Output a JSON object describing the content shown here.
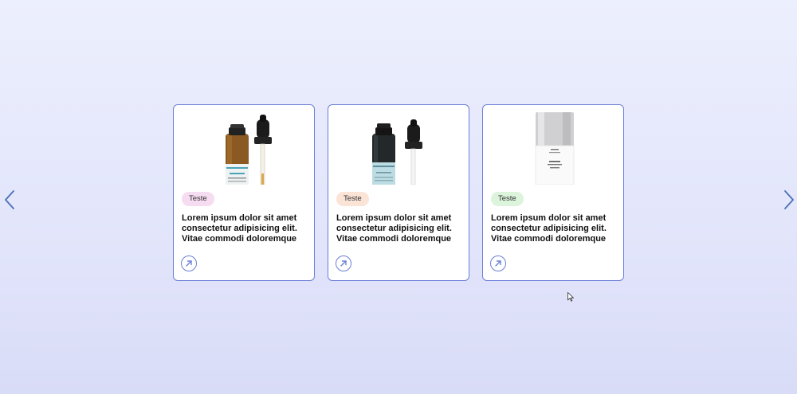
{
  "carousel": {
    "prev_icon": "chevron-left-icon",
    "next_icon": "chevron-right-icon",
    "arrow_color": "#4a6fb5",
    "card_border_color": "#6b7fd7",
    "cards": [
      {
        "tag": "Teste",
        "tag_color": "#f6dcf0",
        "title": "Lorem ipsum dolor sit amet consectetur adipisicing elit. Vitae commodi doloremque",
        "image": "amber-serum-dropper-bottle",
        "link_icon": "arrow-up-right-icon"
      },
      {
        "tag": "Teste",
        "tag_color": "#fbe3d6",
        "title": "Lorem ipsum dolor sit amet consectetur adipisicing elit. Vitae commodi doloremque",
        "image": "dark-serum-dropper-bottle",
        "link_icon": "arrow-up-right-icon"
      },
      {
        "tag": "Teste",
        "tag_color": "#dcf3dc",
        "title": "Lorem ipsum dolor sit amet consectetur adipisicing elit. Vitae commodi doloremque",
        "image": "white-serum-pump-bottle",
        "link_icon": "arrow-up-right-icon"
      }
    ]
  }
}
